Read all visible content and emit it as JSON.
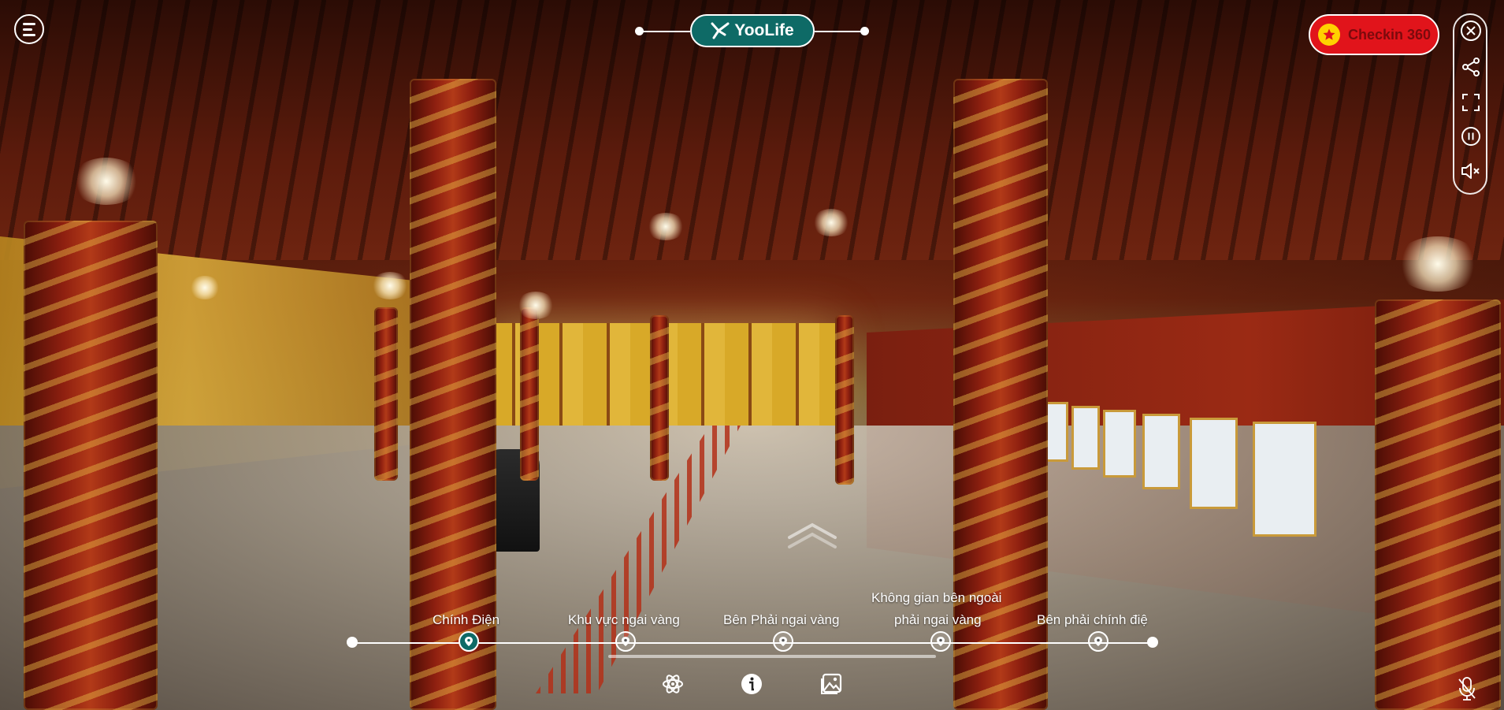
{
  "brand": {
    "name": "YooLife"
  },
  "checkin": {
    "label": "Checkin 360"
  },
  "side_controls": [
    {
      "icon": "close-icon"
    },
    {
      "icon": "share-icon"
    },
    {
      "icon": "fullscreen-icon"
    },
    {
      "icon": "pause-icon"
    },
    {
      "icon": "mute-icon"
    }
  ],
  "timeline": {
    "stops": [
      {
        "label": "Chính Điện",
        "active": true
      },
      {
        "label": "Khu vực ngai vàng",
        "active": false
      },
      {
        "label": "Bên Phải ngai vàng",
        "active": false
      },
      {
        "label_line1": "Không gian bên ngoài",
        "label_line2": "phải ngai vàng",
        "active": false
      },
      {
        "label": "Bên phải chính điệ",
        "active": false
      }
    ]
  },
  "bottom_toolbar": [
    {
      "icon": "atom-icon"
    },
    {
      "icon": "info-icon"
    },
    {
      "icon": "gallery-icon"
    }
  ],
  "colors": {
    "brand_teal": "#0e6a66",
    "checkin_red": "#e1141b",
    "star_yellow": "#ffd200"
  }
}
